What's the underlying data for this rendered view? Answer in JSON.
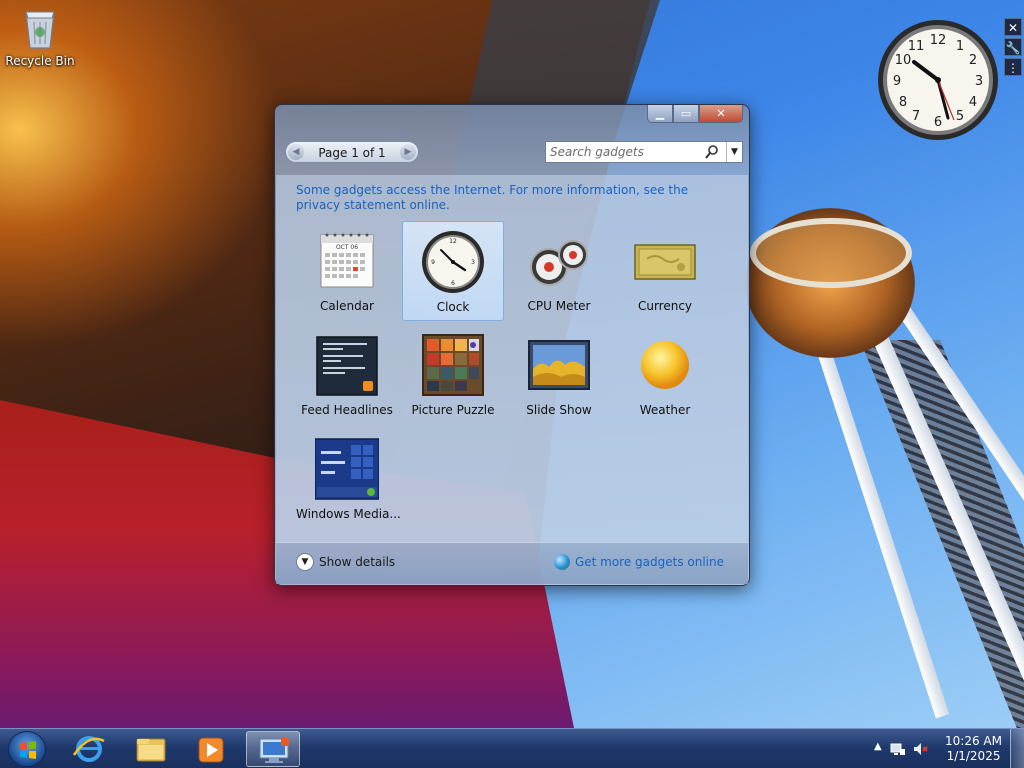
{
  "desktop": {
    "recycle_bin_label": "Recycle Bin"
  },
  "gallery": {
    "pager_label": "Page 1 of 1",
    "search_placeholder": "Search gadgets",
    "notice_text": "Some gadgets access the Internet.  For more information, see the privacy statement online.",
    "selected_gadget": "Clock",
    "gadgets": [
      {
        "name": "Calendar",
        "icon": "calendar-icon"
      },
      {
        "name": "Clock",
        "icon": "clock-icon"
      },
      {
        "name": "CPU Meter",
        "icon": "cpu-meter-icon"
      },
      {
        "name": "Currency",
        "icon": "currency-icon"
      },
      {
        "name": "Feed Headlines",
        "icon": "feed-headlines-icon"
      },
      {
        "name": "Picture Puzzle",
        "icon": "picture-puzzle-icon"
      },
      {
        "name": "Slide Show",
        "icon": "slide-show-icon"
      },
      {
        "name": "Weather",
        "icon": "weather-icon"
      },
      {
        "name": "Windows Media...",
        "icon": "windows-media-icon"
      }
    ],
    "calendar_month": "OCT 06",
    "show_details_label": "Show details",
    "get_more_label": "Get more gadgets online"
  },
  "taskbar": {
    "pinned": [
      "internet-explorer-icon",
      "file-explorer-icon",
      "media-player-icon",
      "gadgets-icon"
    ],
    "time": "10:26 AM",
    "date": "1/1/2025"
  },
  "colors": {
    "link": "#1863c0",
    "taskbar": "#203a6e",
    "close_button": "#c24a33"
  }
}
